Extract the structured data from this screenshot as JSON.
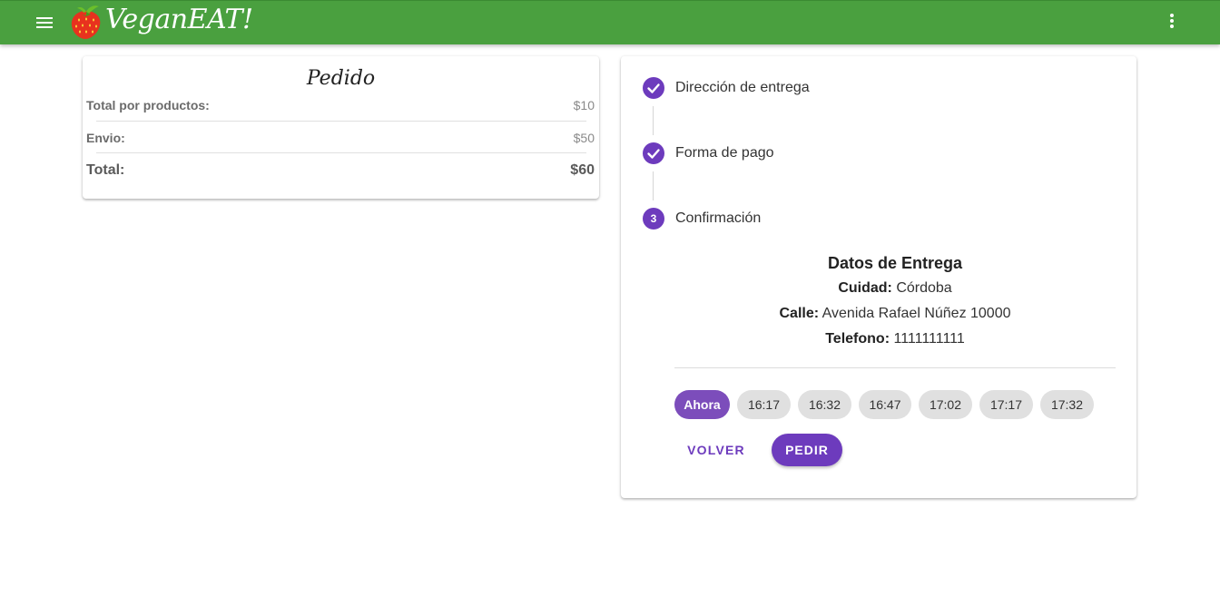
{
  "app": {
    "brand": "VeganEAT!",
    "menu_icon": "hamburger-icon",
    "logo_icon": "strawberry-logo",
    "more_icon": "more-vert-icon",
    "colors": {
      "appbar": "#4aa03f",
      "accent": "#6d3bbd"
    }
  },
  "order": {
    "title": "Pedido",
    "rows": [
      {
        "label": "Total por productos:",
        "value": "$10"
      },
      {
        "label": "Envio:",
        "value": "$50"
      },
      {
        "label": "Total:",
        "value": "$60"
      }
    ]
  },
  "stepper": {
    "steps": [
      {
        "label": "Dirección de entrega",
        "status": "completed",
        "icon": "check-icon"
      },
      {
        "label": "Forma de pago",
        "status": "completed",
        "icon": "check-icon"
      },
      {
        "label": "Confirmación",
        "status": "active",
        "number": "3"
      }
    ],
    "details": {
      "title": "Datos de Entrega",
      "city_label": "Cuidad:",
      "city_value": "Córdoba",
      "street_label": "Calle:",
      "street_value": "Avenida Rafael Núñez 10000",
      "phone_label": "Telefono:",
      "phone_value": "1111111111"
    },
    "time_slots": [
      "Ahora",
      "16:17",
      "16:32",
      "16:47",
      "17:02",
      "17:17",
      "17:32"
    ],
    "selected_slot": "Ahora",
    "back_label": "VOLVER",
    "order_label": "PEDIR"
  }
}
